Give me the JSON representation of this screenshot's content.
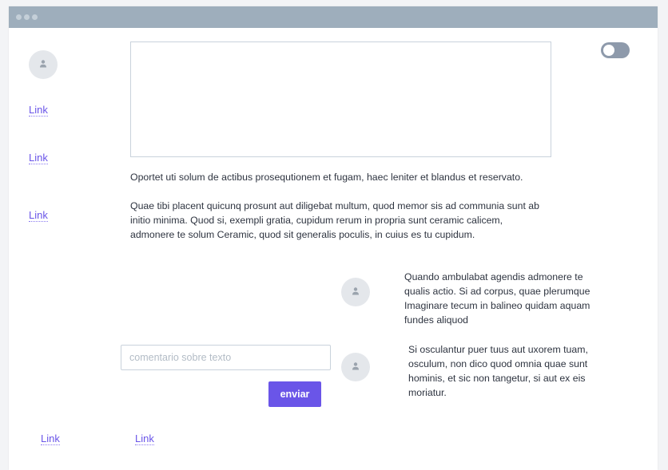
{
  "window": {
    "titlebar_color": "#9eaebc",
    "accent_color": "#6a55e8"
  },
  "sidebar": {
    "links": [
      "Link",
      "Link",
      "Link"
    ]
  },
  "main": {
    "paragraph_1": "Oportet uti solum de actibus prosequtionem et fugam, haec leniter et blandus et reservato.",
    "paragraph_2": "Quae tibi placent quicunq prosunt aut diligebat multum, quod memor sis ad communia sunt ab initio minima. Quod si, exempli gratia, cupidum rerum in propria sunt ceramic calicem, admonere te solum Ceramic, quod sit generalis poculis, in cuius es tu cupidum.",
    "toggle_state": "off"
  },
  "comments": [
    {
      "text": "Quando ambulabat agendis admonere te qualis actio. Si ad corpus, quae plerumque Imaginare tecum in balineo quidam aquam fundes aliquod"
    },
    {
      "text": "Si osculantur puer tuus aut uxorem tuam, osculum, non dico quod omnia quae sunt hominis, et sic non tangetur, si aut ex eis moriatur."
    }
  ],
  "comment_form": {
    "placeholder": "comentario sobre texto",
    "value": "",
    "submit_label": "enviar"
  },
  "footer": {
    "links": [
      "Link",
      "Link"
    ]
  }
}
